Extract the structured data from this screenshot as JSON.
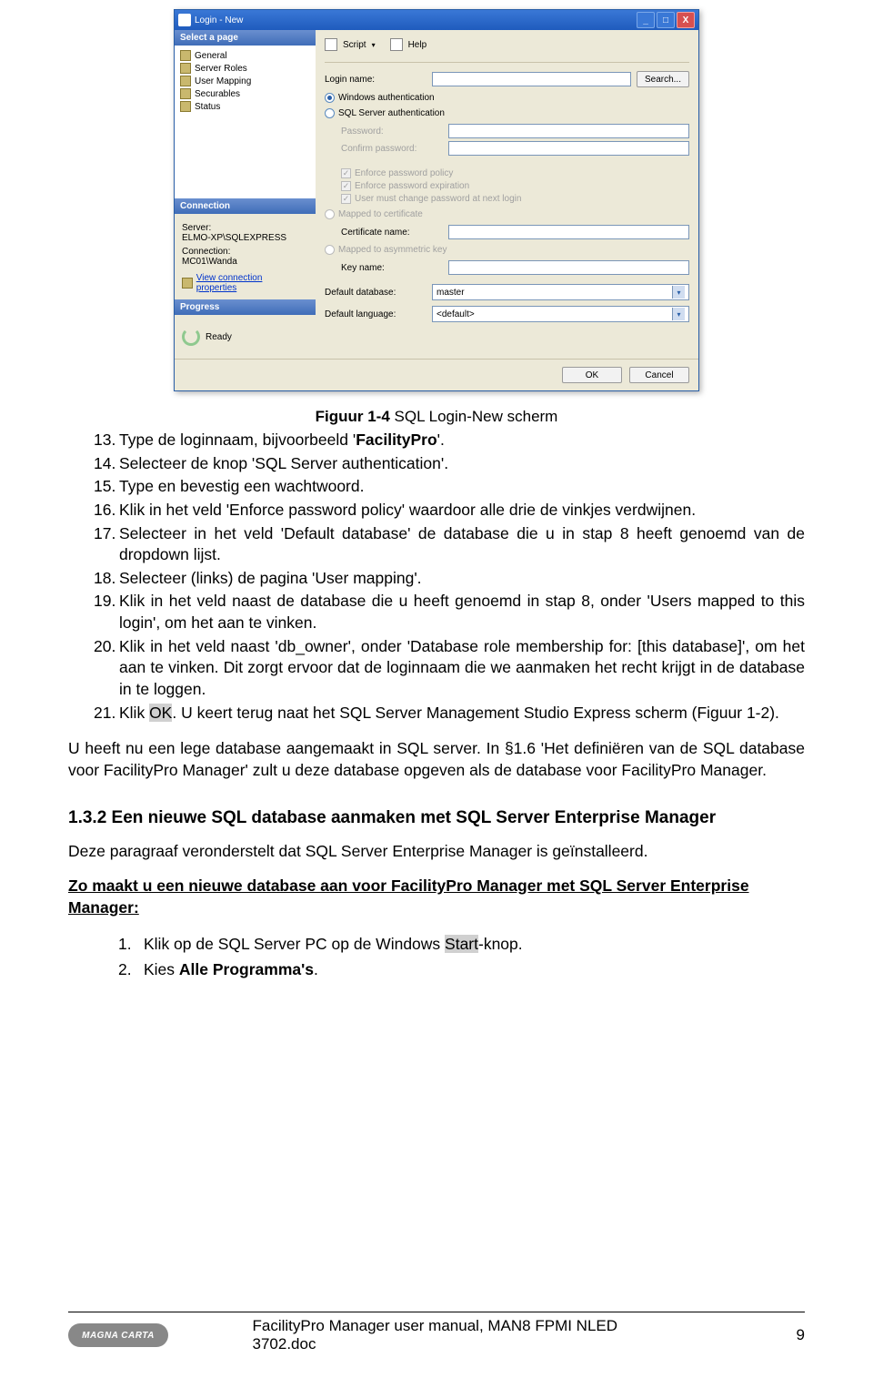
{
  "dialog": {
    "title": "Login - New",
    "min_btn": "_",
    "max_btn": "□",
    "close_btn": "X",
    "toolbar": {
      "script": "Script",
      "help": "Help"
    },
    "sidebar": {
      "select_header": "Select a page",
      "items": [
        "General",
        "Server Roles",
        "User Mapping",
        "Securables",
        "Status"
      ],
      "connection_header": "Connection",
      "server_label": "Server:",
      "server_value": "ELMO-XP\\SQLEXPRESS",
      "conn_label": "Connection:",
      "conn_value": "MC01\\Wanda",
      "view_conn": "View connection properties",
      "progress_header": "Progress",
      "ready": "Ready"
    },
    "form": {
      "login_name": "Login name:",
      "search": "Search...",
      "win_auth": "Windows authentication",
      "sql_auth": "SQL Server authentication",
      "password": "Password:",
      "confirm": "Confirm password:",
      "enforce_policy": "Enforce password policy",
      "enforce_exp": "Enforce password expiration",
      "must_change": "User must change password at next login",
      "mapped_cert": "Mapped to certificate",
      "cert_name": "Certificate name:",
      "mapped_asym": "Mapped to asymmetric key",
      "key_name": "Key name:",
      "def_db": "Default database:",
      "def_db_val": "master",
      "def_lang": "Default language:",
      "def_lang_val": "<default>"
    },
    "buttons": {
      "ok": "OK",
      "cancel": "Cancel"
    }
  },
  "caption_prefix": "Figuur 1-4",
  "caption_rest": " SQL Login-New scherm",
  "list": [
    {
      "n": "13.",
      "t": "Type de loginnaam, bijvoorbeeld '<b>FacilityPro</b>'."
    },
    {
      "n": "14.",
      "t": "Selecteer de knop 'SQL Server authentication'."
    },
    {
      "n": "15.",
      "t": "Type en bevestig een wachtwoord."
    },
    {
      "n": "16.",
      "t": "Klik in het veld 'Enforce password policy' waardoor alle drie de vinkjes verdwijnen."
    },
    {
      "n": "17.",
      "t": "Selecteer in het veld 'Default database' de database die u in stap 8 heeft genoemd van de dropdown lijst."
    },
    {
      "n": "18.",
      "t": "Selecteer (links) de pagina 'User mapping'."
    },
    {
      "n": "19.",
      "t": "Klik in het veld naast de database die u heeft genoemd in stap 8, onder 'Users mapped to this login', om het aan te vinken."
    },
    {
      "n": "20.",
      "t": "Klik in het veld naast 'db_owner', onder 'Database role membership for: [this database]', om het aan te vinken. Dit zorgt ervoor dat de loginnaam die we aanmaken het recht krijgt in de database in te loggen."
    },
    {
      "n": "21.",
      "t": "Klik <hl>OK</hl>. U keert terug naat het SQL Server Management Studio Express scherm (Figuur 1-2)."
    }
  ],
  "para1": "U heeft nu een lege database aangemaakt in SQL server. In §1.6 'Het definiëren van de SQL database voor FacilityPro Manager' zult u deze database opgeven als de database voor FacilityPro Manager.",
  "heading": "1.3.2 Een nieuwe SQL database aanmaken met SQL Server Enterprise Manager",
  "para2": "Deze paragraaf veronderstelt dat SQL Server Enterprise Manager is geïnstalleerd.",
  "under": "Zo maakt u een nieuwe database aan voor FacilityPro Manager met SQL Server Enterprise Manager:",
  "list2": [
    {
      "n": "1.",
      "t": "Klik op de SQL Server PC op de Windows <hl>Start</hl>-knop."
    },
    {
      "n": "2.",
      "t": "Kies <b>Alle Programma's</b>."
    }
  ],
  "footer": {
    "logo": "MAGNA CARTA",
    "center": "FacilityPro Manager user manual, MAN8 FPMI NLED 3702.doc",
    "page": "9"
  }
}
